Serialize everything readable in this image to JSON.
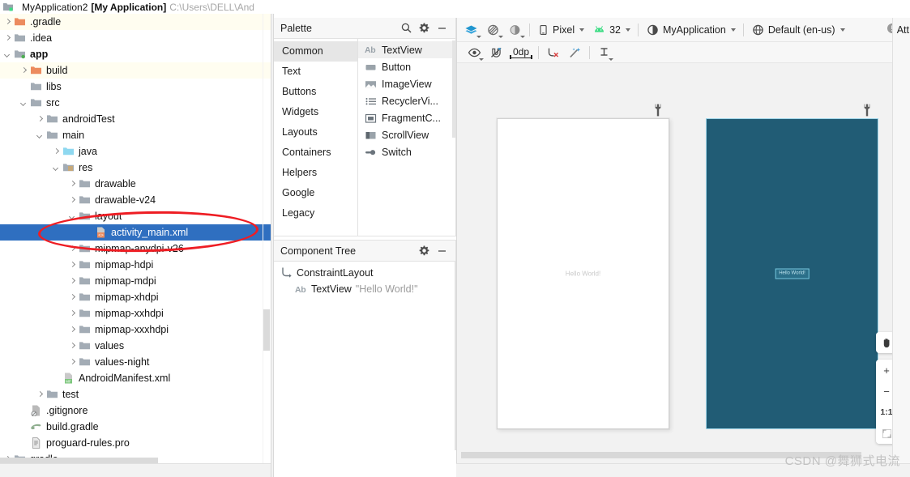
{
  "titlebar": {
    "project_icon": "module-folder-icon",
    "project_name": "MyApplication2",
    "app_label": "[My Application]",
    "path": "C:\\Users\\DELL\\And"
  },
  "project_tree": {
    "rows": [
      {
        "indent": 0,
        "arrow": "right",
        "icon": "folder-orange-icon",
        "label": ".gradle",
        "bold": false,
        "selected": false,
        "alt": true
      },
      {
        "indent": 0,
        "arrow": "right",
        "icon": "folder-gray-icon",
        "label": ".idea",
        "bold": false,
        "selected": false,
        "alt": false
      },
      {
        "indent": 0,
        "arrow": "down",
        "icon": "folder-module-icon",
        "label": "app",
        "bold": true,
        "selected": false,
        "alt": false
      },
      {
        "indent": 1,
        "arrow": "right",
        "icon": "folder-orange-icon",
        "label": "build",
        "bold": false,
        "selected": false,
        "alt": true
      },
      {
        "indent": 1,
        "arrow": "none",
        "icon": "folder-gray-icon",
        "label": "libs",
        "bold": false,
        "selected": false,
        "alt": false
      },
      {
        "indent": 1,
        "arrow": "down",
        "icon": "folder-gray-icon",
        "label": "src",
        "bold": false,
        "selected": false,
        "alt": false
      },
      {
        "indent": 2,
        "arrow": "right",
        "icon": "folder-gray-icon",
        "label": "androidTest",
        "bold": false,
        "selected": false,
        "alt": false
      },
      {
        "indent": 2,
        "arrow": "down",
        "icon": "folder-gray-icon",
        "label": "main",
        "bold": false,
        "selected": false,
        "alt": false
      },
      {
        "indent": 3,
        "arrow": "right",
        "icon": "folder-java-icon",
        "label": "java",
        "bold": false,
        "selected": false,
        "alt": false
      },
      {
        "indent": 3,
        "arrow": "down",
        "icon": "folder-res-icon",
        "label": "res",
        "bold": false,
        "selected": false,
        "alt": false
      },
      {
        "indent": 4,
        "arrow": "right",
        "icon": "folder-gray-icon",
        "label": "drawable",
        "bold": false,
        "selected": false,
        "alt": false
      },
      {
        "indent": 4,
        "arrow": "right",
        "icon": "folder-gray-icon",
        "label": "drawable-v24",
        "bold": false,
        "selected": false,
        "alt": false
      },
      {
        "indent": 4,
        "arrow": "down",
        "icon": "folder-gray-icon",
        "label": "layout",
        "bold": false,
        "selected": false,
        "alt": false
      },
      {
        "indent": 5,
        "arrow": "none",
        "icon": "layout-xml-icon",
        "label": "activity_main.xml",
        "bold": false,
        "selected": true,
        "alt": false
      },
      {
        "indent": 4,
        "arrow": "right",
        "icon": "folder-gray-icon",
        "label": "mipmap-anydpi-v26",
        "bold": false,
        "selected": false,
        "alt": false
      },
      {
        "indent": 4,
        "arrow": "right",
        "icon": "folder-gray-icon",
        "label": "mipmap-hdpi",
        "bold": false,
        "selected": false,
        "alt": false
      },
      {
        "indent": 4,
        "arrow": "right",
        "icon": "folder-gray-icon",
        "label": "mipmap-mdpi",
        "bold": false,
        "selected": false,
        "alt": false
      },
      {
        "indent": 4,
        "arrow": "right",
        "icon": "folder-gray-icon",
        "label": "mipmap-xhdpi",
        "bold": false,
        "selected": false,
        "alt": false
      },
      {
        "indent": 4,
        "arrow": "right",
        "icon": "folder-gray-icon",
        "label": "mipmap-xxhdpi",
        "bold": false,
        "selected": false,
        "alt": false
      },
      {
        "indent": 4,
        "arrow": "right",
        "icon": "folder-gray-icon",
        "label": "mipmap-xxxhdpi",
        "bold": false,
        "selected": false,
        "alt": false
      },
      {
        "indent": 4,
        "arrow": "right",
        "icon": "folder-gray-icon",
        "label": "values",
        "bold": false,
        "selected": false,
        "alt": false
      },
      {
        "indent": 4,
        "arrow": "right",
        "icon": "folder-gray-icon",
        "label": "values-night",
        "bold": false,
        "selected": false,
        "alt": false
      },
      {
        "indent": 3,
        "arrow": "none",
        "icon": "manifest-icon",
        "label": "AndroidManifest.xml",
        "bold": false,
        "selected": false,
        "alt": false
      },
      {
        "indent": 2,
        "arrow": "right",
        "icon": "folder-gray-icon",
        "label": "test",
        "bold": false,
        "selected": false,
        "alt": false
      },
      {
        "indent": 1,
        "arrow": "none",
        "icon": "gitignore-icon",
        "label": ".gitignore",
        "bold": false,
        "selected": false,
        "alt": false
      },
      {
        "indent": 1,
        "arrow": "none",
        "icon": "gradle-file-icon",
        "label": "build.gradle",
        "bold": false,
        "selected": false,
        "alt": false
      },
      {
        "indent": 1,
        "arrow": "none",
        "icon": "text-file-icon",
        "label": "proguard-rules.pro",
        "bold": false,
        "selected": false,
        "alt": false
      },
      {
        "indent": 0,
        "arrow": "right",
        "icon": "folder-gray-icon",
        "label": "gradle",
        "bold": false,
        "selected": false,
        "alt": false
      }
    ],
    "annotation": {
      "shape": "red-ellipse",
      "color": "#ee1d23",
      "targets": "activity_main.xml"
    }
  },
  "palette": {
    "title": "Palette",
    "search_icon": "search-icon",
    "gear_icon": "gear-icon",
    "minimize_icon": "minimize-icon",
    "categories": [
      {
        "label": "Common",
        "active": true
      },
      {
        "label": "Text",
        "active": false
      },
      {
        "label": "Buttons",
        "active": false
      },
      {
        "label": "Widgets",
        "active": false
      },
      {
        "label": "Layouts",
        "active": false
      },
      {
        "label": "Containers",
        "active": false
      },
      {
        "label": "Helpers",
        "active": false
      },
      {
        "label": "Google",
        "active": false
      },
      {
        "label": "Legacy",
        "active": false
      }
    ],
    "items": [
      {
        "label": "TextView",
        "icon": "textview-ab-icon",
        "active": true
      },
      {
        "label": "Button",
        "icon": "button-icon",
        "active": false
      },
      {
        "label": "ImageView",
        "icon": "imageview-icon",
        "active": false
      },
      {
        "label": "RecyclerVi...",
        "icon": "recyclerview-icon",
        "active": false
      },
      {
        "label": "FragmentC...",
        "icon": "fragment-icon",
        "active": false
      },
      {
        "label": "ScrollView",
        "icon": "scrollview-icon",
        "active": false
      },
      {
        "label": "Switch",
        "icon": "switch-icon",
        "active": false
      }
    ]
  },
  "component_tree": {
    "title": "Component Tree",
    "gear_icon": "gear-icon",
    "minimize_icon": "minimize-icon",
    "nodes": [
      {
        "icon": "constraintlayout-icon",
        "label": "ConstraintLayout",
        "value": "",
        "indent": 0
      },
      {
        "icon": "textview-ab-icon",
        "label": "TextView",
        "value": "\"Hello World!\"",
        "indent": 1
      }
    ]
  },
  "design_toolbar": {
    "row1": [
      {
        "name": "design-mode-button",
        "icon": "layers-icon",
        "label": "",
        "has_caret": true
      },
      {
        "name": "orientation-button",
        "icon": "orientation-icon",
        "label": "",
        "has_caret": true
      },
      {
        "name": "night-mode-button",
        "icon": "night-mode-icon",
        "label": "",
        "has_caret": true
      },
      {
        "name": "device-selector",
        "icon": "phone-icon",
        "label": "Pixel",
        "has_caret": true
      },
      {
        "name": "api-selector",
        "icon": "android-icon",
        "label": "32",
        "has_caret": true
      },
      {
        "name": "theme-selector",
        "icon": "theme-icon",
        "label": "MyApplication",
        "has_caret": true
      },
      {
        "name": "locale-selector",
        "icon": "globe-icon",
        "label": "Default (en-us)",
        "has_caret": true
      }
    ],
    "issues_icon": "warning-icon",
    "attributes_label": "Att",
    "row2": [
      {
        "name": "view-options-button",
        "icon": "eye-icon",
        "label": "",
        "has_caret": true
      },
      {
        "name": "autoconnect-button",
        "icon": "magnet-off-icon",
        "label": "",
        "has_caret": false
      },
      {
        "name": "default-margin-button",
        "icon": "margin-icon",
        "label": "0dp",
        "has_caret": false
      },
      {
        "name": "clear-constraints-button",
        "icon": "clear-constraints-icon",
        "label": "",
        "has_caret": false
      },
      {
        "name": "infer-constraints-button",
        "icon": "magic-wand-icon",
        "label": "",
        "has_caret": false
      },
      {
        "name": "baseline-align-button",
        "icon": "baseline-icon",
        "label": "",
        "has_caret": true
      }
    ],
    "help_icon": "help-icon"
  },
  "canvas": {
    "design_preview": {
      "name": "design-preview",
      "wrench_icon": "wrench-icon",
      "hello_text": "Hello World!",
      "background": "#ffffff"
    },
    "blueprint_preview": {
      "name": "blueprint-preview",
      "wrench_icon": "wrench-icon",
      "hello_text": "Hello World!",
      "background": "#215c75",
      "widget_border": "#76c6dd"
    },
    "zoom_controls": [
      {
        "name": "pan-button",
        "icon": "hand-icon",
        "label": ""
      },
      {
        "name": "zoom-in-button",
        "icon": "plus-icon",
        "label": "+"
      },
      {
        "name": "zoom-out-button",
        "icon": "minus-icon",
        "label": "−"
      },
      {
        "name": "zoom-actual-button",
        "icon": "one-to-one-icon",
        "label": "1:1"
      },
      {
        "name": "zoom-fit-button",
        "icon": "fit-screen-icon",
        "label": ""
      }
    ]
  },
  "watermark": {
    "text": "CSDN @舞狮式电流"
  },
  "colors": {
    "selection_blue": "#2f6fc0",
    "annotation_red": "#ee1d23",
    "blueprint_teal": "#215c75",
    "folder_orange": "#ec8b5e",
    "folder_gray": "#a3acb5"
  }
}
